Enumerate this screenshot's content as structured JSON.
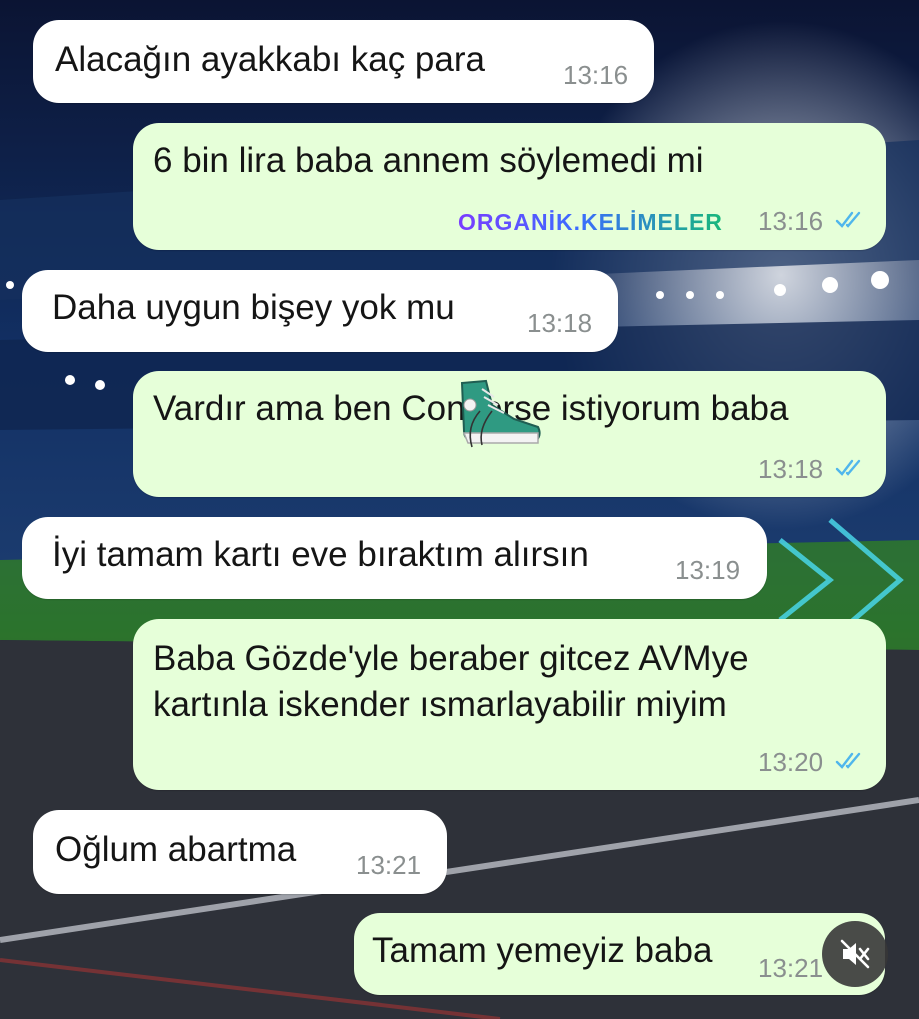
{
  "watermark": "ORGANİK.KELİMELER",
  "colors": {
    "incoming_bubble": "#ffffff",
    "outgoing_bubble": "#e6ffd9",
    "read_ticks": "#4fb6ec",
    "timestamp": "#8a8f8f"
  },
  "messages": [
    {
      "dir": "in",
      "lines": [
        "Alacağın ayakkabı kaç para"
      ],
      "time": "13:16"
    },
    {
      "dir": "out",
      "lines": [
        "6 bin lira baba annem söylemedi mi"
      ],
      "time": "13:16"
    },
    {
      "dir": "in",
      "lines": [
        "Daha uygun bişey yok mu"
      ],
      "time": "13:18"
    },
    {
      "dir": "out",
      "lines": [
        "Vardır ama ben Converse istiyorum baba"
      ],
      "time": "13:18"
    },
    {
      "dir": "in",
      "lines": [
        "İyi tamam kartı eve bıraktım alırsın"
      ],
      "time": "13:19"
    },
    {
      "dir": "out",
      "lines": [
        "Baba Gözde'yle beraber gitcez AVMye",
        "kartınla iskender ısmarlayabilir miyim"
      ],
      "time": "13:20"
    },
    {
      "dir": "in",
      "lines": [
        "Oğlum abartma"
      ],
      "time": "13:21"
    },
    {
      "dir": "out",
      "lines": [
        "Tamam yemeyiz baba"
      ],
      "time": "13:21"
    }
  ],
  "icons": {
    "sticker": "sneaker-icon",
    "video_control": "speaker-muted-icon",
    "read_receipt": "double-check-icon"
  }
}
